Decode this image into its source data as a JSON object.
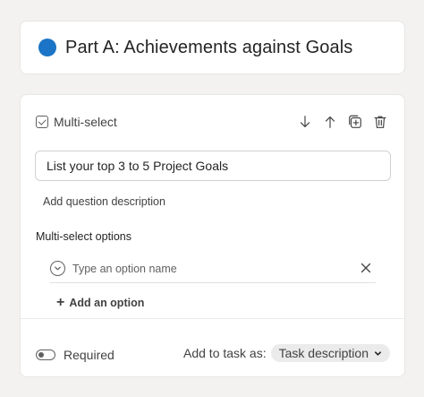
{
  "section": {
    "title": "Part A: Achievements against Goals",
    "dot_color": "#1b74c5"
  },
  "question": {
    "type_label": "Multi-select",
    "text": "List your top 3 to 5 Project Goals",
    "add_description_label": "Add question description",
    "options_label": "Multi-select options",
    "options": [
      {
        "placeholder": "Type an option name",
        "value": ""
      }
    ],
    "add_option_label": "Add an option"
  },
  "footer": {
    "required_label": "Required",
    "required_on": false,
    "add_to_task_label": "Add to task as:",
    "task_value": "Task description"
  },
  "icons": {
    "move_down": "arrow-down-icon",
    "move_up": "arrow-up-icon",
    "duplicate": "duplicate-icon",
    "delete": "trash-icon"
  }
}
